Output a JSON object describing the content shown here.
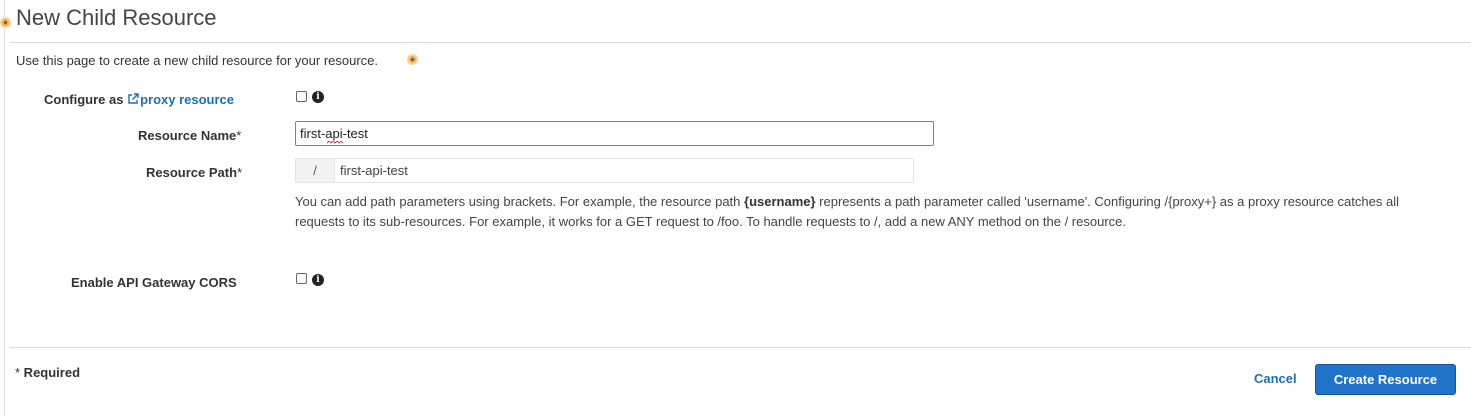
{
  "page": {
    "title": "New Child Resource",
    "description": "Use this page to create a new child resource for your resource."
  },
  "form": {
    "configure_label": "Configure as ",
    "proxy_link": "proxy resource",
    "resource_name_label": "Resource Name",
    "resource_name_value": "first-api-test",
    "resource_path_label": "Resource Path",
    "resource_path_prefix": "/",
    "resource_path_value": "first-api-test",
    "help_part1": "You can add path parameters using brackets. For example, the resource path ",
    "help_bold": "{username}",
    "help_part2": " represents a path parameter called 'username'. Configuring /{proxy+} as a proxy resource catches all requests to its sub-resources. For example, it works for a GET request to /foo. To handle requests to /, add a new ANY method on the / resource.",
    "cors_label": "Enable API Gateway CORS",
    "required_star": "*",
    "required_note": " Required"
  },
  "actions": {
    "cancel": "Cancel",
    "create": "Create Resource"
  },
  "icons": {
    "info": "i",
    "external_link": "external-link-icon"
  },
  "colors": {
    "link": "#1f6fb5",
    "primary_button": "#1f73c9",
    "focus_border": "#3d8fd6",
    "marker": "#f7a93a"
  }
}
